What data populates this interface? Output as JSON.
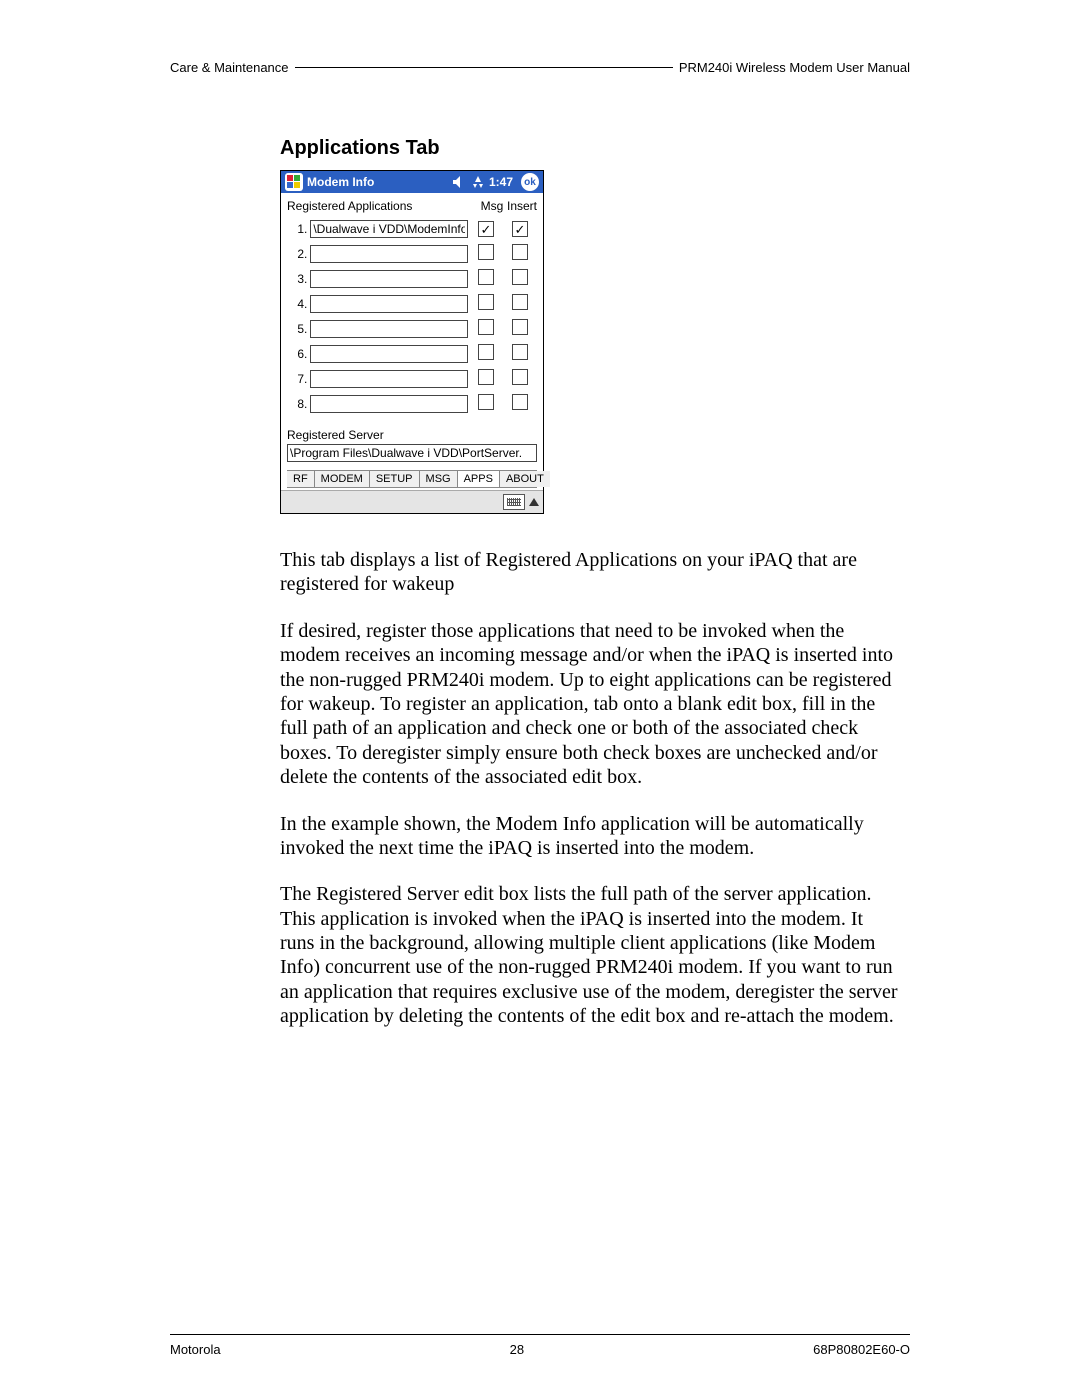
{
  "header": {
    "left": "Care & Maintenance",
    "right": "PRM240i Wireless Modem User Manual"
  },
  "section_heading": "Applications Tab",
  "screenshot": {
    "title": "Modem Info",
    "time": "1:47",
    "ok": "ok",
    "reg_apps_label": "Registered Applications",
    "col_msg": "Msg",
    "col_insert": "Insert",
    "rows": [
      {
        "num": "1.",
        "path": "\\Dualwave i VDD\\ModemInfo",
        "msg": true,
        "insert": true
      },
      {
        "num": "2.",
        "path": "",
        "msg": false,
        "insert": false
      },
      {
        "num": "3.",
        "path": "",
        "msg": false,
        "insert": false
      },
      {
        "num": "4.",
        "path": "",
        "msg": false,
        "insert": false
      },
      {
        "num": "5.",
        "path": "",
        "msg": false,
        "insert": false
      },
      {
        "num": "6.",
        "path": "",
        "msg": false,
        "insert": false
      },
      {
        "num": "7.",
        "path": "",
        "msg": false,
        "insert": false
      },
      {
        "num": "8.",
        "path": "",
        "msg": false,
        "insert": false
      }
    ],
    "server_label": "Registered Server",
    "server_path": "\\Program Files\\Dualwave i VDD\\PortServer.",
    "tabs": [
      "RF",
      "MODEM",
      "SETUP",
      "MSG",
      "APPS",
      "ABOUT"
    ],
    "active_tab": 4
  },
  "paras": [
    "This tab displays a list of Registered Applications on your iPAQ that are registered for wakeup",
    "If desired, register those applications that need to be invoked when the modem receives an incoming message and/or when the iPAQ is inserted into the non-rugged PRM240i modem. Up to eight applications can be registered for wakeup. To register an application, tab onto a blank edit box, fill in the full path of an application and check one or both of the associated check boxes. To deregister simply ensure both check boxes are unchecked and/or delete the contents of the associated edit box.",
    "In the example shown, the Modem Info application will be automatically invoked the next time the iPAQ is inserted into the modem.",
    "The Registered Server edit box lists the full path of the server application. This application is invoked when the iPAQ is inserted into the modem. It runs in the background, allowing multiple client applications (like Modem Info) concurrent use of the non-rugged PRM240i modem. If you want to run an application that requires exclusive use of the modem, deregister the server application by deleting the contents of the edit box and re-attach the modem."
  ],
  "footer": {
    "left": "Motorola",
    "center": "28",
    "right": "68P80802E60-O"
  }
}
